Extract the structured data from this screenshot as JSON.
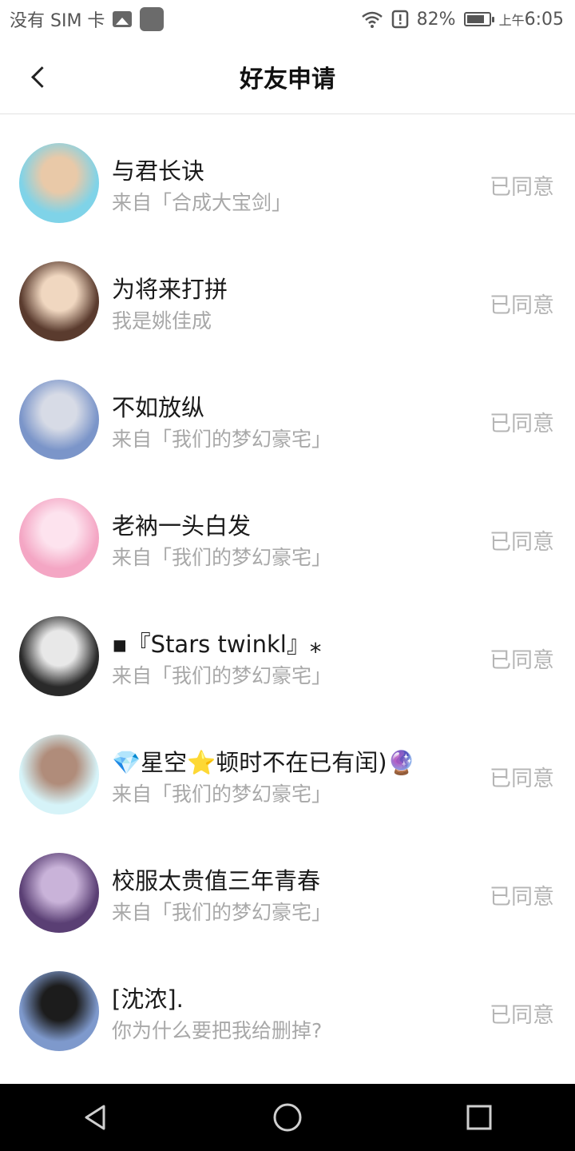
{
  "status_bar": {
    "carrier": "没有 SIM 卡",
    "battery": "82%",
    "battery_level": 0.82,
    "time_prefix": "上午",
    "time": "6:05",
    "icons": [
      "image-icon",
      "app-icon",
      "wifi-icon",
      "alert-icon",
      "battery-icon"
    ]
  },
  "header": {
    "title": "好友申请",
    "back_icon": "chevron-left-icon"
  },
  "requests": [
    {
      "name": "与君长诀",
      "message": "来自「合成大宝剑」",
      "status": "已同意",
      "avatar_colors": [
        "#7fd3e8",
        "#e9c9a8"
      ]
    },
    {
      "name": "为将来打拼",
      "message": "我是姚佳成",
      "status": "已同意",
      "avatar_colors": [
        "#5a3b2e",
        "#f0d7c0"
      ]
    },
    {
      "name": "不如放纵",
      "message": "来自「我们的梦幻豪宅」",
      "status": "已同意",
      "avatar_colors": [
        "#7b95c9",
        "#d7dbe6"
      ]
    },
    {
      "name": "老衲一头白发",
      "message": "来自「我们的梦幻豪宅」",
      "status": "已同意",
      "avatar_colors": [
        "#f4a6c4",
        "#fde3ee"
      ]
    },
    {
      "name": "▪『Stars twinkl』⁎",
      "message": "来自「我们的梦幻豪宅」",
      "status": "已同意",
      "avatar_colors": [
        "#2a2a2a",
        "#e8e8e8"
      ]
    },
    {
      "name": "💎星空⭐顿时不在已有闰)🔮",
      "message": "来自「我们的梦幻豪宅」",
      "status": "已同意",
      "avatar_colors": [
        "#d6f3f8",
        "#b08c7a"
      ]
    },
    {
      "name": "校服太贵值三年青春",
      "message": "来自「我们的梦幻豪宅」",
      "status": "已同意",
      "avatar_colors": [
        "#5a3f74",
        "#c9b3d9"
      ]
    },
    {
      "name": "[沈浓].",
      "message": "你为什么要把我给删掉?",
      "status": "已同意",
      "avatar_colors": [
        "#7e99cc",
        "#1c1c1c"
      ]
    }
  ],
  "nav_bar": {
    "back_icon": "triangle-back-icon",
    "home_icon": "circle-home-icon",
    "recents_icon": "square-recents-icon"
  }
}
